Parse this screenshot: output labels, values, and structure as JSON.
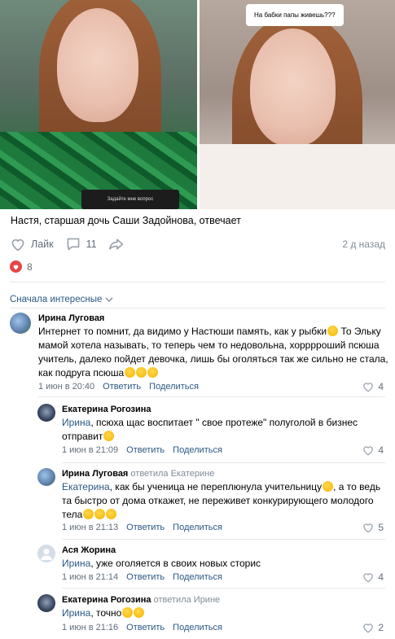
{
  "post": {
    "question": "На бабки папы живешь???",
    "story_prompt": "Задайте мне вопрос",
    "text": "Настя, старшая дочь Саши Задойнова, отвечает",
    "like_label": "Лайк",
    "comments_count": "11",
    "time_ago": "2 д назад",
    "likes_count": "8"
  },
  "sort_label": "Сначала интересные",
  "comments": [
    {
      "author": "Ирина Луговая",
      "replied": "",
      "text": "Интернет то помнит, да видимо у Настюши память, как у рыбки",
      "text2": " То Эльку мамой хотела называть, то теперь чем то недовольна, хорррроший псюша учитель, далеко пойдет девочка, лишь бы оголяться так же сильно не стала, как подруга псюша",
      "date": "1 июн в 20:40",
      "reply": "Ответить",
      "share": "Поделиться",
      "likes": "4"
    },
    {
      "author": "Екатерина Рогозина",
      "replied": "",
      "mention": "Ирина",
      "text": ", псюха щас воспитает \" свое протеже\" полуголой в бизнес отправит",
      "date": "1 июн в 21:09",
      "reply": "Ответить",
      "share": "Поделиться",
      "likes": "4"
    },
    {
      "author": "Ирина Луговая",
      "replied": "ответила Екатерине",
      "mention": "Екатерина",
      "text": ", как бы ученица не переплюнула учительницу",
      "text2": ", а то ведь та быстро от дома откажет, не переживет конкурирующего молодого тела",
      "date": "1 июн в 21:13",
      "reply": "Ответить",
      "share": "Поделиться",
      "likes": "5"
    },
    {
      "author": "Ася Жорина",
      "replied": "",
      "mention": "Ирина",
      "text": ", уже оголяется в своих новых сторис",
      "date": "1 июн в 21:14",
      "reply": "Ответить",
      "share": "Поделиться",
      "likes": "4"
    },
    {
      "author": "Екатерина Рогозина",
      "replied": "ответила Ирине",
      "mention": "Ирина",
      "text": ", точно",
      "date": "1 июн в 21:16",
      "reply": "Ответить",
      "share": "Поделиться",
      "likes": "2"
    }
  ]
}
